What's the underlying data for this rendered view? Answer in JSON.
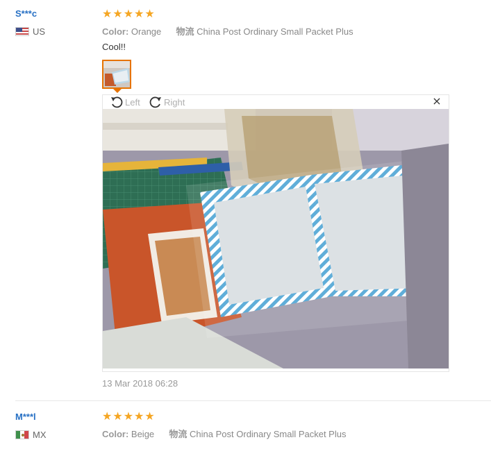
{
  "reviews": [
    {
      "user": "S***c",
      "country": "US",
      "rating": 5,
      "attributes": [
        {
          "key": "Color:",
          "value": "Orange"
        },
        {
          "key": "物流",
          "value": "China Post Ordinary Small Packet Plus"
        }
      ],
      "text": "Cool!!",
      "viewer": {
        "rotate_left": "Left",
        "rotate_right": "Right",
        "close": "×"
      },
      "date": "13 Mar 2018 06:28"
    },
    {
      "user": "M***l",
      "country": "MX",
      "rating": 5,
      "attributes": [
        {
          "key": "Color:",
          "value": "Beige"
        },
        {
          "key": "物流",
          "value": "China Post Ordinary Small Packet Plus"
        }
      ]
    }
  ],
  "colors": {
    "star": "#f5a623",
    "username": "#2770c4",
    "accent": "#e67300"
  },
  "icons": {
    "rotate_left": "rotate-left-icon",
    "rotate_right": "rotate-right-icon",
    "close": "close-icon",
    "star": "star-icon"
  }
}
